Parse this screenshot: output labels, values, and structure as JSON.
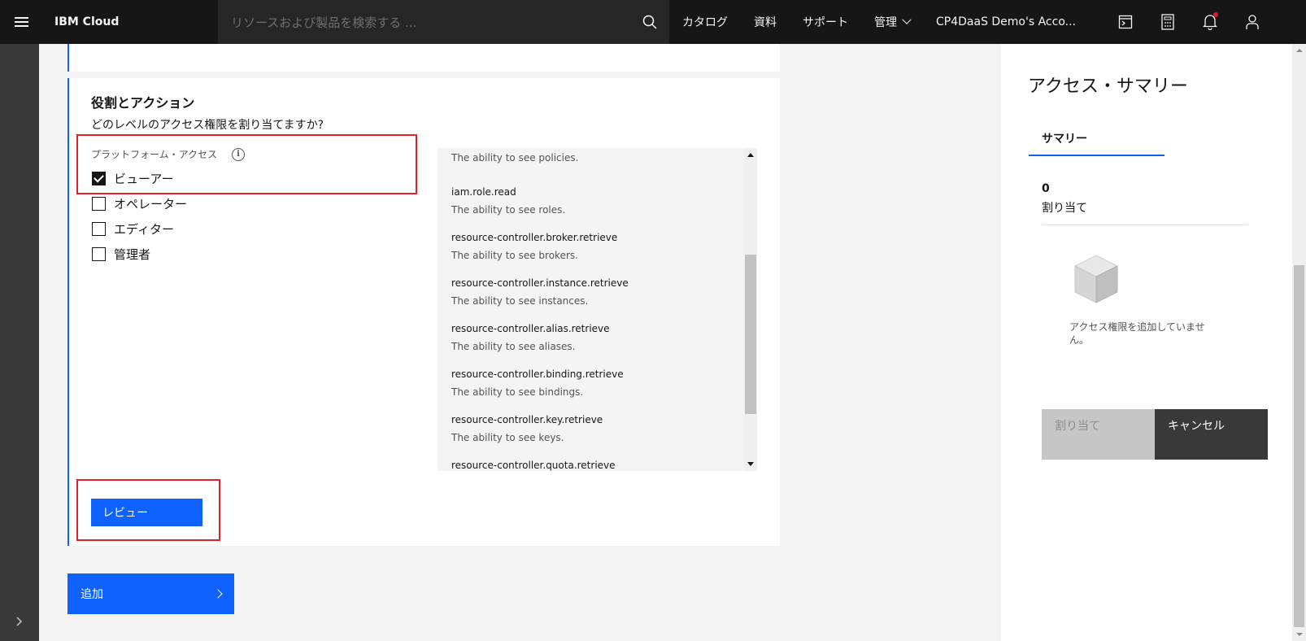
{
  "header": {
    "brand": "IBM Cloud",
    "search_placeholder": "リソースおよび製品を検索する ...",
    "nav": [
      "カタログ",
      "資料",
      "サポート",
      "管理"
    ],
    "account": "CP4DaaS Demo's Acco..."
  },
  "main": {
    "role_title": "役割とアクション",
    "role_question": "どのレベルのアクセス権限を割り当てますか?",
    "platform_label": "プラットフォーム・アクセス",
    "roles": [
      {
        "label": "ビューアー",
        "checked": true
      },
      {
        "label": "オペレーター",
        "checked": false
      },
      {
        "label": "エディター",
        "checked": false
      },
      {
        "label": "管理者",
        "checked": false
      }
    ],
    "actions": [
      {
        "name": "",
        "desc": "The ability to see policies."
      },
      {
        "name": "iam.role.read",
        "desc": "The ability to see roles."
      },
      {
        "name": "resource-controller.broker.retrieve",
        "desc": "The ability to see brokers."
      },
      {
        "name": "resource-controller.instance.retrieve",
        "desc": "The ability to see instances."
      },
      {
        "name": "resource-controller.alias.retrieve",
        "desc": "The ability to see aliases."
      },
      {
        "name": "resource-controller.binding.retrieve",
        "desc": "The ability to see bindings."
      },
      {
        "name": "resource-controller.key.retrieve",
        "desc": "The ability to see keys."
      },
      {
        "name": "resource-controller.quota.retrieve",
        "desc": ""
      }
    ],
    "review_label": "レビュー",
    "add_label": "追加"
  },
  "summary": {
    "title": "アクセス・サマリー",
    "tab": "サマリー",
    "count": "0",
    "count_label": "割り当て",
    "empty_text": "アクセス権限を追加していません。",
    "assign_label": "割り当て",
    "cancel_label": "キャンセル"
  },
  "colors": {
    "accent": "#0f62fe",
    "highlight": "#e0212a",
    "topbar": "#161616"
  }
}
